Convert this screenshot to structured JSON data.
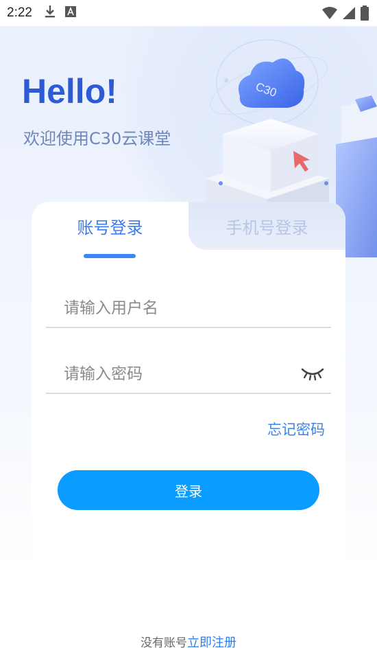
{
  "status_bar": {
    "time": "2:22",
    "icons": [
      "download-icon",
      "a-notification-icon",
      "wifi-icon",
      "signal-icon",
      "battery-icon"
    ]
  },
  "hero": {
    "greeting": "Hello!",
    "welcome": "欢迎使用C30云课堂",
    "cloud_label": "C30"
  },
  "login_card": {
    "tabs": [
      {
        "label": "账号登录",
        "active": true
      },
      {
        "label": "手机号登录",
        "active": false
      }
    ],
    "username_placeholder": "请输入用户名",
    "password_placeholder": "请输入密码",
    "forgot_label": "忘记密码",
    "login_label": "登录"
  },
  "footer": {
    "prompt": "没有账号",
    "register_label": "立即注册"
  },
  "colors": {
    "accent": "#3b7bf1",
    "login_button": "#0a9cff",
    "greeting": "#2d5bd8"
  }
}
